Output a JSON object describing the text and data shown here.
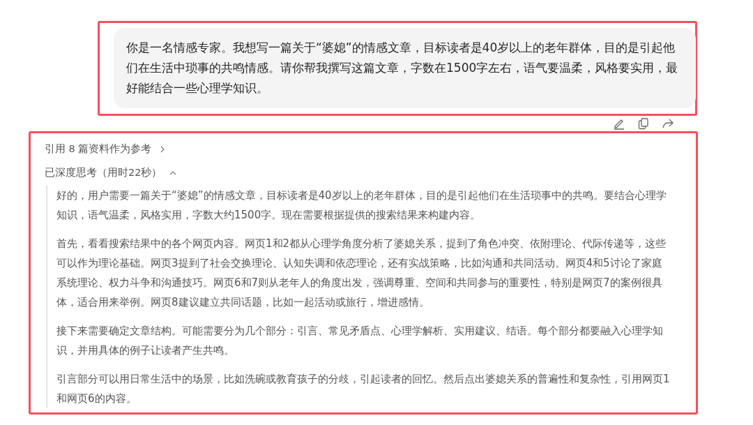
{
  "user_message": {
    "text": "你是一名情感专家。我想写一篇关于“婆媳”的情感文章，目标读者是40岁以上的老年群体，目的是引起他们在生活中琐事的共鸣情感。请你帮我撰写这篇文章，字数在1500字左右，语气要温柔，风格要实用，最好能结合一些心理学知识。"
  },
  "assistant": {
    "references": {
      "label": "引用 8 篇资料作为参考",
      "expanded": false
    },
    "thinking": {
      "label": "已深度思考（用时22秒）",
      "expanded": true,
      "paragraphs": [
        "好的，用户需要一篇关于“婆媳”的情感文章，目标读者是40岁以上的老年群体，目的是引起他们在生活琐事中的共鸣。要结合心理学知识，语气温柔，风格实用，字数大约1500字。现在需要根据提供的搜索结果来构建内容。",
        "首先，看看搜索结果中的各个网页内容。网页1和2都从心理学角度分析了婆媳关系，提到了角色冲突、依附理论、代际传递等，这些可以作为理论基础。网页3提到了社会交换理论、认知失调和依恋理论，还有实战策略，比如沟通和共同活动。网页4和5讨论了家庭系统理论、权力斗争和沟通技巧。网页6和7则从老年人的角度出发，强调尊重、空间和共同参与的重要性，特别是网页7的案例很具体，适合用来举例。网页8建议建立共同话题，比如一起活动或旅行，增进感情。",
        "接下来需要确定文章结构。可能需要分为几个部分：引言、常见矛盾点、心理学解析、实用建议、结语。每个部分都要融入心理学知识，并用具体的例子让读者产生共鸣。",
        "引言部分可以用日常生活中的场景，比如洗碗或教育孩子的分歧，引起读者的回忆。然后点出婆媳关系的普遍性和复杂性，引用网页1和网页6的内容。"
      ]
    }
  }
}
